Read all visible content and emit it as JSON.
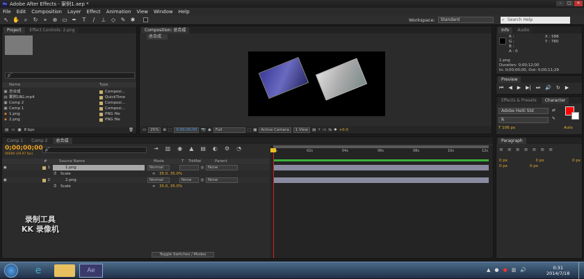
{
  "window": {
    "title": "Adobe After Effects - 案例1.aep *",
    "app_icon": "Ae"
  },
  "menu": [
    "File",
    "Edit",
    "Composition",
    "Layer",
    "Effect",
    "Animation",
    "View",
    "Window",
    "Help"
  ],
  "toolbar": {
    "workspace_label": "Workspace:",
    "workspace_value": "Standard",
    "search_placeholder": "Search Help"
  },
  "project_panel": {
    "tabs": [
      "Project",
      "Effect Controls: 2.png"
    ],
    "search_placeholder": "ρ˜",
    "columns": [
      "Name",
      "Type"
    ],
    "items": [
      {
        "name": "总合成",
        "type": "Composi…",
        "icon": "composition-icon",
        "swatch": "#c8b070"
      },
      {
        "name": "案例1BG.mp4",
        "type": "QuickTime",
        "icon": "footage-icon",
        "swatch": "#c8b070"
      },
      {
        "name": "Comp 2",
        "type": "Composi…",
        "icon": "composition-icon",
        "swatch": "#c8b070"
      },
      {
        "name": "Comp 1",
        "type": "Composi…",
        "icon": "composition-icon",
        "swatch": "#c8b070"
      },
      {
        "name": "1.png",
        "type": "PNG file",
        "icon": "image-icon",
        "swatch": "#c8b070"
      },
      {
        "name": "2.png",
        "type": "PNG file",
        "icon": "image-icon",
        "swatch": "#c8b070"
      }
    ],
    "bpc": "8 bpc"
  },
  "composition_panel": {
    "tab": "Composition: 总合成",
    "subtab": "总合成",
    "zoom": "25%",
    "timecode": "0;00;00;00",
    "resolution": "Full",
    "camera": "Active Camera",
    "views": "1 View",
    "offset": "+0.0"
  },
  "info_panel": {
    "tabs": [
      "Info",
      "Audio"
    ],
    "r": "R :",
    "g": "G :",
    "b": "B :",
    "a": "A : 0",
    "x": "X : 588",
    "y": "Y : 780",
    "file": "1.png",
    "duration": "Duration: 0;00;12;00",
    "in_out": "In: 0;00;00;00, Out: 0;00;11;29"
  },
  "preview_panel": {
    "tab": "Preview"
  },
  "effects_panel": {
    "tabs": [
      "Effects & Presets",
      "Character"
    ],
    "font": "Adobe Heiti Std",
    "style": "R",
    "size": "T 106 px",
    "tracking": "Auto"
  },
  "paragraph_panel": {
    "tab": "Paragraph",
    "values": [
      "0 px",
      "0 px",
      "0 px",
      "0 px",
      "0 px"
    ]
  },
  "timeline": {
    "tabs": [
      "Comp 1",
      "Comp 2",
      "总合成"
    ],
    "timecode": "0;00;00;00",
    "fps": "00000 (29.97 fps)",
    "search_placeholder": "ρ˜",
    "columns": [
      "#",
      "Source Name",
      "Mode",
      "T",
      "TrkMat",
      "Parent"
    ],
    "layers": [
      {
        "num": "1",
        "name": "1.png",
        "mode": "Normal",
        "trkmat": "",
        "parent": "None",
        "prop": "Scale",
        "value": "35.0, 35.0%"
      },
      {
        "num": "2",
        "name": "2.png",
        "mode": "Normal",
        "trkmat": "None",
        "parent": "None",
        "prop": "Scale",
        "value": "35.0, 35.0%"
      }
    ],
    "ruler": [
      "0s",
      "02s",
      "04s",
      "06s",
      "08s",
      "10s",
      "12s"
    ],
    "toggle_label": "Toggle Switches / Modes"
  },
  "watermark": {
    "line1": "录制工具",
    "line2": "KK 录像机"
  },
  "taskbar": {
    "time": "0:31",
    "date": "2014/7/18"
  },
  "colors": {
    "fg_swatch": "#ff0000",
    "timeline_green": "#3ab03a",
    "playhead": "#e02020",
    "time_blue": "#4a9ef0"
  }
}
